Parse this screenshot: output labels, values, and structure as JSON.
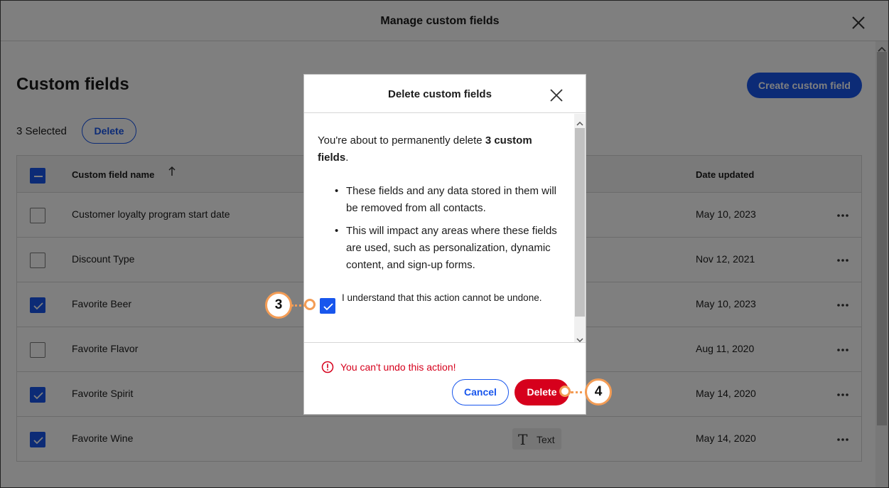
{
  "window": {
    "title": "Manage custom fields"
  },
  "page": {
    "title": "Custom fields",
    "create_button": "Create custom field",
    "selected_text": "3 Selected",
    "bulk_delete_button": "Delete"
  },
  "table": {
    "columns": {
      "name": "Custom field name",
      "date": "Date updated"
    },
    "rows": [
      {
        "name": "Customer loyalty program start date",
        "date": "May 10, 2023",
        "checked": false
      },
      {
        "name": "Discount Type",
        "date": "Nov 12, 2021",
        "checked": false
      },
      {
        "name": "Favorite Beer",
        "date": "May 10, 2023",
        "checked": true
      },
      {
        "name": "Favorite Flavor",
        "date": "Aug 11, 2020",
        "checked": false
      },
      {
        "name": "Favorite Spirit",
        "date": "May 14, 2020",
        "checked": true
      },
      {
        "name": "Favorite Wine",
        "date": "May 14, 2020",
        "checked": true,
        "type": "Text"
      }
    ],
    "more_glyph": "•••"
  },
  "dialog": {
    "title": "Delete custom fields",
    "intro_prefix": "You're about to permanently delete ",
    "intro_bold": "3 custom fields",
    "intro_suffix": ".",
    "bullets": [
      "These fields and any data stored in them will be removed from all contacts.",
      "This will impact any areas where these fields are used, such as personalization, dynamic content, and sign-up forms."
    ],
    "acknowledge": "I understand that this action cannot be undone.",
    "warning": "You can't undo this action!",
    "cancel_button": "Cancel",
    "delete_button": "Delete"
  },
  "callouts": {
    "step3": "3",
    "step4": "4"
  },
  "colors": {
    "primary": "#1856ed",
    "danger": "#d6001c",
    "callout": "#f39c55"
  }
}
